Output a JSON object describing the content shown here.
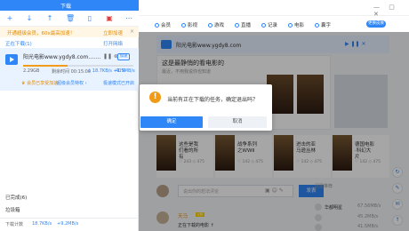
{
  "window": {
    "title": "下载"
  },
  "toolbar": {
    "items": [
      {
        "icon": "add-icon",
        "glyph": "+"
      },
      {
        "icon": "download-icon",
        "glyph": "↓"
      },
      {
        "icon": "upload-icon",
        "glyph": "↑"
      },
      {
        "icon": "delete-icon",
        "glyph": "🗑"
      },
      {
        "icon": "phone-icon",
        "glyph": "▯"
      },
      {
        "icon": "gift-icon",
        "glyph": "▣"
      },
      {
        "icon": "more-icon",
        "glyph": "⋯"
      }
    ]
  },
  "vip_bar": {
    "text": "开通超级会员，60x最高加速！",
    "button": "立即加速",
    "close": "×"
  },
  "downloading": {
    "header": "正在下载(1)",
    "right_link": "打开网络"
  },
  "task": {
    "file_name": "阳光电影www.ygdy8.com.……",
    "controls": "❚❚ ⊗",
    "badge": "加速",
    "size": "2.29GB",
    "eta": "剩余时间 00:15:00",
    "speed": "↓ 18.7KB/s +1.9MB/s",
    "percent": "40%",
    "progress": 0.4,
    "members": "♛ 会员已享受加速",
    "link1": "超级会员特权 ›",
    "link2": "极速模式已开启"
  },
  "sidebar": {
    "done": "已完成(6)",
    "trash": "垃圾箱"
  },
  "status": {
    "label": "下载计数",
    "speed": "18.7KB/s",
    "extra": "+9.2MB/s"
  },
  "nav": {
    "items": [
      "会员",
      "影视",
      "游戏",
      "直播",
      "记录",
      "电影",
      "囊字"
    ],
    "button": "更换皮肤"
  },
  "player": {
    "name": "阳光电影www.ygdy8.com",
    "controls": "▶ ❚❚ ✕"
  },
  "card": {
    "title": "这是最静悄的看电影的",
    "sub": "最近，不用我说你也知道"
  },
  "movies": [
    {
      "name": "这些是我们看的所有",
      "stat": "♡ 243 ◇ 475"
    },
    {
      "name": "战争系列之WWⅡ",
      "stat": "♡ 142 ◇ 475"
    },
    {
      "name": "进击的亚马逊丛林",
      "stat": "♡ 142 ◇ 475"
    },
    {
      "name": "德国电影·科幻大片",
      "stat": "♡ 142 ◇ 475"
    }
  ],
  "comment": {
    "placeholder": "说出你的想法评论",
    "send": "发表",
    "icons": "▣ ☺ ✎"
  },
  "user": {
    "name": "天马",
    "tag": "VIP",
    "text": "正在下载的电影 ↑"
  },
  "recommend": {
    "header": "迅雷推荐",
    "items": [
      {
        "name": "华都明星",
        "size": "67.56MB/s"
      },
      {
        "name": "",
        "size": "45.2MB/s"
      },
      {
        "name": "",
        "size": "41.5MB/s"
      }
    ]
  },
  "dialog": {
    "message": "当前有正在下载的任务，确定退出吗？",
    "ok": "确定",
    "cancel": "取消",
    "icon_glyph": "!"
  },
  "colors": {
    "accent": "#2f86f6",
    "warning": "#f19a16",
    "vip": "#e38b00"
  }
}
